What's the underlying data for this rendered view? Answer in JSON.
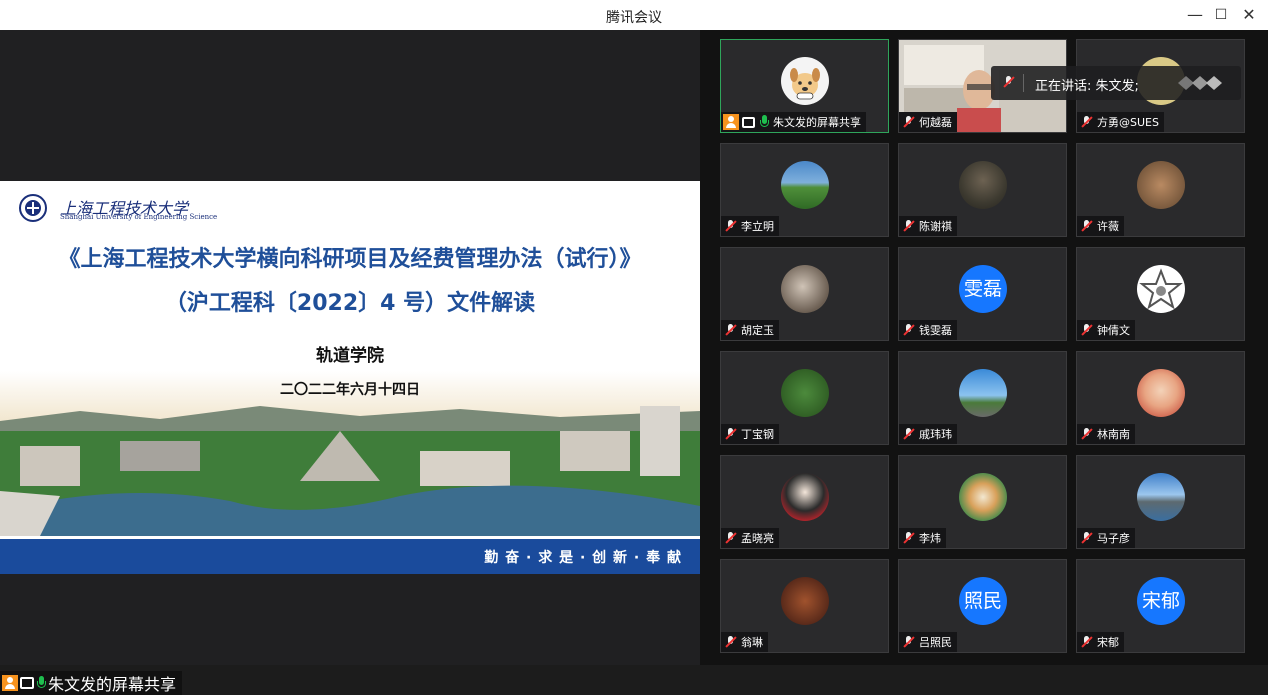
{
  "window": {
    "title": "腾讯会议",
    "minimize": "—",
    "maximize": "☐",
    "close": "✕"
  },
  "slide": {
    "university_name": "上海工程技术大学",
    "university_en": "Shanghai University of Engineering Science",
    "title_line1": "《上海工程技术大学横向科研项目及经费管理办法（试行）》",
    "title_line2": "（沪工程科〔2022〕4 号）文件解读",
    "department": "轨道学院",
    "date": "二〇二二年六月十四日",
    "motto": "勤 奋 · 求 是 · 创 新 · 奉 献"
  },
  "share_label": "朱文发的屏幕共享",
  "speaking": {
    "text": "正在讲话: 朱文发;"
  },
  "participants": [
    {
      "name": "朱文发的屏幕共享",
      "avatar": "cartoon-dog"
    },
    {
      "name": "何越磊",
      "avatar": "video"
    },
    {
      "name": "方勇@SUES",
      "avatar": "photo"
    },
    {
      "name": "李立明",
      "avatar": "photo"
    },
    {
      "name": "陈谢祺",
      "avatar": "photo"
    },
    {
      "name": "许薇",
      "avatar": "photo"
    },
    {
      "name": "胡定玉",
      "avatar": "photo"
    },
    {
      "name": "钱雯磊",
      "avatar_text": "雯磊"
    },
    {
      "name": "钟倩文",
      "avatar": "star"
    },
    {
      "name": "丁宝钢",
      "avatar": "photo"
    },
    {
      "name": "戚玮玮",
      "avatar": "photo"
    },
    {
      "name": "林南南",
      "avatar": "photo"
    },
    {
      "name": "孟晓亮",
      "avatar": "photo"
    },
    {
      "name": "李炜",
      "avatar": "photo"
    },
    {
      "name": "马子彦",
      "avatar": "photo"
    },
    {
      "name": "翁琳",
      "avatar": "photo"
    },
    {
      "name": "吕照民",
      "avatar_text": "照民"
    },
    {
      "name": "宋郁",
      "avatar_text": "宋郁"
    }
  ],
  "colors": {
    "accent_blue": "#1677ff",
    "active_speaker": "#2fa55b",
    "slide_title": "#1f4f99",
    "banner": "#1a4b9c"
  }
}
